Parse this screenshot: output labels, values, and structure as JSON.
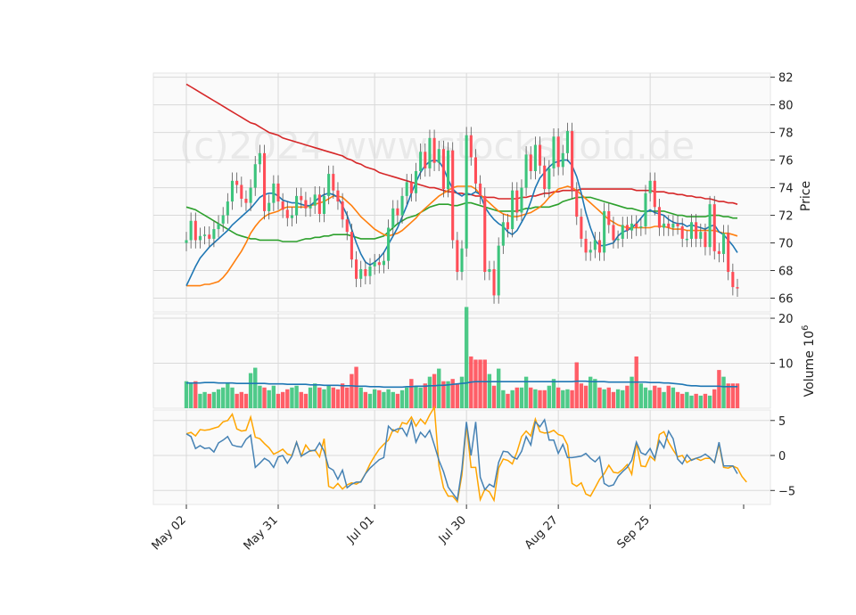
{
  "watermark": "(c)2024 www.stocksfloid.de",
  "colors": {
    "up": "#3cc47c",
    "down": "#ff4d57",
    "ma_fast": "#1f77b4",
    "ma_mid": "#ff7f0e",
    "ma_slow": "#2ca02c",
    "ma_long": "#d62728",
    "vol_ma": "#1f77b4",
    "macd": "#4682b4",
    "signal": "#ffa500"
  },
  "chart_data": {
    "type": "candlestick",
    "x_tick_labels": [
      "May 02",
      "May 31",
      "Jul 01",
      "Jul 30",
      "Aug 27",
      "Sep 25"
    ],
    "x_tick_index": [
      0,
      20,
      41,
      61,
      81,
      101
    ],
    "price_axis": {
      "label": "Price",
      "ticks": [
        66,
        68,
        70,
        72,
        74,
        76,
        78,
        80,
        82
      ],
      "ylim": [
        65,
        82.3
      ]
    },
    "volume_axis": {
      "label": "Volume  10^6",
      "ticks": [
        10,
        20
      ],
      "ylim": [
        0,
        21
      ]
    },
    "macd_axis": {
      "ticks": [
        -5,
        0,
        5
      ],
      "ylim": [
        -7,
        6.5
      ]
    },
    "close": [
      70.2,
      71.6,
      70.2,
      70.5,
      70.6,
      70.3,
      71.0,
      71.4,
      72.0,
      73.0,
      74.5,
      74.2,
      73.2,
      72.9,
      74.0,
      75.7,
      76.5,
      72.3,
      72.9,
      74.3,
      73.0,
      72.4,
      71.8,
      72.0,
      73.4,
      73.1,
      72.5,
      72.7,
      73.5,
      72.1,
      73.4,
      75.0,
      73.8,
      73.0,
      71.7,
      70.8,
      68.8,
      67.4,
      68.1,
      67.6,
      68.3,
      68.6,
      68.4,
      68.7,
      71.1,
      72.5,
      72.0,
      73.4,
      74.4,
      73.6,
      75.2,
      76.6,
      75.4,
      77.6,
      75.8,
      76.8,
      73.9,
      76.7,
      70.2,
      67.9,
      69.6,
      77.8,
      76.2,
      74.3,
      73.4,
      67.9,
      68.1,
      66.2,
      69.8,
      71.5,
      71.0,
      73.8,
      72.2,
      74.0,
      76.4,
      75.2,
      77.1,
      75.6,
      73.9,
      75.4,
      77.7,
      75.5,
      76.5,
      78.1,
      73.8,
      71.9,
      70.3,
      69.3,
      69.5,
      70.2,
      69.3,
      72.3,
      71.3,
      70.2,
      70.3,
      71.3,
      70.9,
      71.4,
      71.1,
      71.2,
      73.6,
      74.5,
      72.6,
      71.1,
      71.4,
      71.1,
      71.4,
      71.2,
      70.3,
      70.3,
      71.5,
      70.3,
      70.8,
      69.7,
      72.8,
      69.4,
      69.2,
      70.7,
      67.9,
      66.8,
      66.7
    ],
    "open": [
      70.0,
      70.2,
      71.6,
      70.2,
      70.5,
      70.6,
      70.3,
      71.0,
      71.4,
      72.0,
      73.0,
      74.5,
      74.2,
      73.2,
      72.9,
      74.0,
      75.7,
      76.5,
      72.3,
      72.9,
      74.3,
      73.0,
      72.4,
      71.8,
      72.0,
      73.4,
      73.1,
      72.5,
      72.7,
      73.5,
      72.1,
      73.4,
      75.0,
      73.8,
      73.0,
      71.7,
      70.8,
      68.8,
      67.4,
      68.1,
      67.6,
      68.3,
      68.6,
      68.4,
      68.7,
      71.1,
      72.5,
      72.0,
      73.4,
      74.4,
      73.6,
      75.2,
      76.6,
      75.4,
      77.6,
      75.8,
      76.8,
      73.9,
      76.7,
      70.2,
      67.9,
      69.6,
      77.8,
      76.2,
      74.3,
      73.4,
      67.9,
      68.1,
      66.2,
      69.8,
      71.5,
      71.0,
      73.8,
      72.2,
      74.0,
      76.4,
      75.2,
      77.1,
      75.6,
      73.9,
      75.4,
      77.7,
      75.5,
      76.5,
      78.1,
      73.8,
      71.9,
      70.3,
      69.3,
      69.5,
      70.2,
      69.3,
      72.3,
      71.3,
      70.2,
      70.3,
      71.3,
      70.9,
      71.4,
      71.1,
      71.2,
      73.6,
      74.5,
      72.6,
      71.1,
      71.4,
      71.1,
      71.4,
      71.2,
      70.3,
      70.3,
      71.5,
      70.3,
      70.8,
      69.7,
      72.8,
      69.4,
      69.2,
      70.7,
      67.9,
      66.8
    ],
    "volume": [
      6.0,
      5.5,
      6.0,
      3.2,
      3.6,
      3.2,
      3.6,
      4.2,
      4.6,
      5.5,
      4.6,
      3.2,
      3.6,
      3.2,
      7.8,
      9.0,
      5.0,
      4.6,
      4.0,
      5.0,
      3.2,
      3.6,
      4.2,
      4.6,
      5.0,
      3.6,
      3.2,
      4.6,
      5.5,
      4.6,
      4.2,
      5.0,
      4.6,
      4.2,
      5.5,
      4.6,
      7.6,
      9.2,
      4.6,
      3.6,
      3.2,
      4.2,
      4.0,
      3.6,
      4.2,
      3.6,
      3.2,
      4.0,
      4.6,
      6.5,
      5.0,
      4.6,
      5.5,
      7.0,
      7.6,
      8.8,
      6.0,
      6.0,
      6.5,
      5.5,
      7.0,
      22.5,
      11.5,
      10.8,
      10.8,
      10.8,
      7.6,
      5.0,
      8.8,
      4.0,
      3.2,
      4.0,
      4.6,
      4.6,
      7.0,
      4.6,
      4.2,
      4.0,
      4.0,
      5.0,
      6.5,
      4.6,
      4.0,
      4.2,
      4.0,
      10.2,
      5.5,
      5.0,
      7.0,
      6.5,
      4.6,
      4.2,
      4.6,
      3.6,
      4.2,
      4.0,
      5.0,
      7.0,
      11.5,
      5.5,
      4.6,
      4.0,
      5.0,
      4.6,
      3.6,
      5.0,
      4.6,
      3.6,
      3.2,
      3.6,
      2.8,
      3.2,
      2.8,
      3.2,
      2.8,
      4.2,
      8.5,
      7.0,
      5.5,
      5.5,
      5.5
    ],
    "ma_fast": [
      66.9,
      67.6,
      68.3,
      68.9,
      69.3,
      69.7,
      70.0,
      70.3,
      70.6,
      70.9,
      71.3,
      71.6,
      71.9,
      72.2,
      72.5,
      72.9,
      73.3,
      73.5,
      73.6,
      73.6,
      73.4,
      73.1,
      73.0,
      72.9,
      72.9,
      72.8,
      72.7,
      72.7,
      73.0,
      73.3,
      73.5,
      73.6,
      73.5,
      73.3,
      72.7,
      72.0,
      71.0,
      70.0,
      69.2,
      68.6,
      68.4,
      68.6,
      68.9,
      69.3,
      69.9,
      70.5,
      71.1,
      71.9,
      72.7,
      73.6,
      74.4,
      75.1,
      75.6,
      75.9,
      76.0,
      75.9,
      75.4,
      74.6,
      73.9,
      73.6,
      73.4,
      73.6,
      73.5,
      73.7,
      73.5,
      72.6,
      72.1,
      71.7,
      71.4,
      71.2,
      70.8,
      70.6,
      70.9,
      71.5,
      72.1,
      73.0,
      74.0,
      74.7,
      75.1,
      75.5,
      75.8,
      75.9,
      76.0,
      76.0,
      75.6,
      74.8,
      73.6,
      72.2,
      71.1,
      70.2,
      69.8,
      69.8,
      69.9,
      70.0,
      70.5,
      70.8,
      70.9,
      71.1,
      71.4,
      71.8,
      72.2,
      72.4,
      72.2,
      72.1,
      72.0,
      71.7,
      71.5,
      71.4,
      71.4,
      71.2,
      71.3,
      71.2,
      71.1,
      71.0,
      71.2,
      71.3,
      70.8,
      70.6,
      70.2,
      69.8,
      69.3
    ],
    "ma_mid": [
      66.9,
      66.9,
      66.9,
      66.9,
      67.0,
      67.0,
      67.1,
      67.2,
      67.5,
      67.9,
      68.4,
      68.9,
      69.4,
      70.0,
      70.7,
      71.2,
      71.6,
      71.9,
      72.1,
      72.2,
      72.3,
      72.5,
      72.6,
      72.6,
      72.6,
      72.6,
      72.6,
      72.7,
      72.8,
      72.9,
      73.0,
      73.2,
      73.4,
      73.4,
      73.3,
      73.0,
      72.7,
      72.3,
      71.9,
      71.6,
      71.3,
      71.0,
      70.8,
      70.6,
      70.5,
      70.6,
      70.7,
      70.9,
      71.2,
      71.5,
      71.8,
      72.2,
      72.5,
      72.8,
      73.1,
      73.4,
      73.6,
      73.8,
      74.0,
      74.1,
      74.1,
      74.1,
      74.1,
      73.9,
      73.5,
      73.2,
      72.9,
      72.6,
      72.3,
      72.1,
      72.0,
      71.9,
      71.9,
      72.0,
      72.1,
      72.2,
      72.4,
      72.6,
      72.9,
      73.3,
      73.6,
      73.9,
      74.0,
      74.1,
      74.0,
      73.8,
      73.5,
      73.2,
      72.9,
      72.6,
      72.3,
      72.0,
      71.7,
      71.5,
      71.3,
      71.2,
      71.1,
      71.1,
      71.1,
      71.1,
      71.1,
      71.1,
      71.2,
      71.2,
      71.2,
      71.1,
      71.0,
      71.0,
      71.0,
      70.9,
      70.9,
      70.9,
      70.9,
      70.9,
      70.9,
      70.9,
      70.8,
      70.7,
      70.7,
      70.6,
      70.5
    ],
    "ma_slow": [
      72.6,
      72.5,
      72.4,
      72.2,
      72.0,
      71.8,
      71.6,
      71.4,
      71.2,
      71.0,
      70.8,
      70.6,
      70.5,
      70.4,
      70.3,
      70.3,
      70.2,
      70.2,
      70.2,
      70.2,
      70.2,
      70.1,
      70.1,
      70.1,
      70.1,
      70.2,
      70.3,
      70.3,
      70.4,
      70.4,
      70.5,
      70.5,
      70.6,
      70.6,
      70.6,
      70.6,
      70.5,
      70.4,
      70.3,
      70.3,
      70.3,
      70.3,
      70.4,
      70.5,
      70.8,
      71.1,
      71.4,
      71.6,
      71.8,
      71.9,
      72.0,
      72.2,
      72.4,
      72.6,
      72.7,
      72.8,
      72.8,
      72.8,
      72.7,
      72.7,
      72.8,
      72.9,
      72.9,
      72.8,
      72.7,
      72.6,
      72.5,
      72.4,
      72.3,
      72.3,
      72.3,
      72.3,
      72.3,
      72.4,
      72.5,
      72.5,
      72.6,
      72.6,
      72.6,
      72.6,
      72.7,
      72.8,
      73.0,
      73.1,
      73.2,
      73.3,
      73.3,
      73.3,
      73.3,
      73.2,
      73.1,
      73.0,
      72.9,
      72.8,
      72.7,
      72.6,
      72.5,
      72.5,
      72.4,
      72.3,
      72.3,
      72.3,
      72.3,
      72.3,
      72.3,
      72.2,
      72.1,
      72.0,
      72.0,
      71.9,
      71.9,
      71.9,
      71.9,
      71.9,
      72.0,
      72.0,
      72.0,
      71.9,
      71.9,
      71.8,
      71.8
    ],
    "ma_long": [
      81.5,
      81.3,
      81.1,
      80.9,
      80.7,
      80.5,
      80.3,
      80.1,
      79.9,
      79.7,
      79.5,
      79.3,
      79.1,
      78.9,
      78.7,
      78.6,
      78.4,
      78.2,
      78.0,
      77.9,
      77.8,
      77.6,
      77.5,
      77.4,
      77.3,
      77.2,
      77.1,
      77.0,
      76.9,
      76.8,
      76.7,
      76.6,
      76.5,
      76.4,
      76.3,
      76.1,
      76.0,
      75.8,
      75.7,
      75.5,
      75.4,
      75.3,
      75.1,
      75.0,
      74.9,
      74.8,
      74.7,
      74.6,
      74.5,
      74.4,
      74.3,
      74.2,
      74.1,
      74.0,
      74.0,
      73.9,
      73.8,
      73.7,
      73.7,
      73.6,
      73.6,
      73.5,
      73.5,
      73.4,
      73.4,
      73.3,
      73.3,
      73.3,
      73.2,
      73.2,
      73.2,
      73.2,
      73.2,
      73.3,
      73.3,
      73.4,
      73.4,
      73.5,
      73.6,
      73.6,
      73.7,
      73.7,
      73.8,
      73.8,
      73.8,
      73.8,
      73.9,
      73.9,
      73.9,
      73.9,
      73.9,
      73.9,
      73.9,
      73.9,
      73.9,
      73.9,
      73.9,
      73.9,
      73.8,
      73.8,
      73.8,
      73.8,
      73.7,
      73.7,
      73.7,
      73.6,
      73.6,
      73.5,
      73.5,
      73.4,
      73.4,
      73.3,
      73.3,
      73.2,
      73.2,
      73.1,
      73.0,
      73.0,
      72.9,
      72.9,
      72.8
    ],
    "vol_ma": [
      5.6,
      5.6,
      5.6,
      5.6,
      5.7,
      5.7,
      5.7,
      5.6,
      5.6,
      5.6,
      5.6,
      5.5,
      5.5,
      5.5,
      5.5,
      5.5,
      5.5,
      5.5,
      5.4,
      5.4,
      5.4,
      5.4,
      5.3,
      5.3,
      5.3,
      5.3,
      5.3,
      5.2,
      5.2,
      5.2,
      5.1,
      5.1,
      5.1,
      5.1,
      5.0,
      5.0,
      5.0,
      4.9,
      4.9,
      4.9,
      4.8,
      4.8,
      4.8,
      4.7,
      4.7,
      4.7,
      4.7,
      4.7,
      4.8,
      4.8,
      4.9,
      4.9,
      4.9,
      5.0,
      5.0,
      5.1,
      5.1,
      5.2,
      5.3,
      5.4,
      5.5,
      5.6,
      5.8,
      5.9,
      5.9,
      5.9,
      5.9,
      5.9,
      5.9,
      5.9,
      5.9,
      5.9,
      5.9,
      5.9,
      5.9,
      5.9,
      5.9,
      5.9,
      5.9,
      5.9,
      5.9,
      5.9,
      5.9,
      5.9,
      5.9,
      6.0,
      6.0,
      6.0,
      5.9,
      5.9,
      5.9,
      5.9,
      5.8,
      5.8,
      5.8,
      5.8,
      5.8,
      5.8,
      5.8,
      5.8,
      5.8,
      5.7,
      5.7,
      5.7,
      5.6,
      5.6,
      5.5,
      5.4,
      5.3,
      5.1,
      5.0,
      5.0,
      4.9,
      4.9,
      4.9,
      4.9,
      4.9,
      4.8,
      4.8,
      4.8,
      4.8
    ],
    "macd": [
      3.1,
      2.7,
      1.0,
      1.4,
      1.0,
      1.1,
      0.5,
      1.8,
      2.2,
      2.7,
      1.5,
      1.3,
      1.2,
      2.3,
      2.9,
      -1.7,
      -1.1,
      -0.4,
      -0.8,
      -1.7,
      -0.2,
      0.0,
      -1.1,
      -0.1,
      1.9,
      -0.1,
      0.3,
      0.7,
      0.7,
      1.8,
      0.6,
      -1.7,
      -2.1,
      -3.4,
      -2.1,
      -4.6,
      -4.1,
      -3.8,
      -3.8,
      -2.6,
      -1.8,
      -1.2,
      -0.6,
      -0.3,
      4.2,
      3.5,
      3.8,
      3.9,
      2.8,
      4.9,
      1.9,
      3.3,
      2.6,
      3.6,
      1.5,
      -0.7,
      -2.3,
      -4.5,
      -5.4,
      -6.3,
      -2.0,
      4.8,
      0.0,
      4.8,
      -3.1,
      -4.9,
      -4.1,
      -4.5,
      -1.0,
      0.6,
      0.5,
      -0.2,
      -0.5,
      0.6,
      2.7,
      1.5,
      4.8,
      4.1,
      5.1,
      2.2,
      2.2,
      0.3,
      1.6,
      -0.3,
      -0.3,
      -0.2,
      -0.1,
      0.3,
      -0.4,
      -0.9,
      -0.2,
      -4.0,
      -4.4,
      -4.2,
      -3.0,
      -2.3,
      -1.7,
      -0.7,
      1.9,
      0.4,
      0.1,
      1.0,
      -0.4,
      2.1,
      1.1,
      3.5,
      2.4,
      -0.5,
      -1.2,
      0.1,
      -0.7,
      -0.4,
      -0.2,
      0.2,
      -0.3,
      -1.0,
      1.9,
      -1.5,
      -1.5,
      -1.5,
      -2.6
    ],
    "signal": [
      3.1,
      3.3,
      2.8,
      3.7,
      3.6,
      3.7,
      3.9,
      4.1,
      4.8,
      5.0,
      5.9,
      3.8,
      3.5,
      3.6,
      5.5,
      2.6,
      2.4,
      1.7,
      1.1,
      0.2,
      0.5,
      0.9,
      0.2,
      0.0,
      1.9,
      -0.1,
      1.5,
      0.6,
      0.8,
      -0.2,
      2.4,
      -4.4,
      -4.7,
      -4.0,
      -4.8,
      -4.2,
      -3.9,
      -4.1,
      -3.7,
      -2.6,
      -1.2,
      -0.1,
      0.9,
      1.6,
      2.2,
      3.7,
      3.3,
      4.7,
      4.5,
      5.5,
      4.2,
      5.2,
      4.5,
      5.8,
      6.9,
      -1.5,
      -4.6,
      -5.8,
      -5.8,
      -6.6,
      -2.8,
      4.4,
      -1.7,
      -1.7,
      -6.3,
      -4.8,
      -5.2,
      -6.4,
      -1.8,
      -0.5,
      -0.7,
      -1.2,
      0.5,
      2.7,
      3.5,
      2.8,
      5.2,
      3.4,
      3.2,
      3.3,
      3.6,
      3.0,
      2.8,
      1.5,
      -4.0,
      -4.4,
      -3.9,
      -5.5,
      -5.8,
      -4.6,
      -3.4,
      -2.6,
      -1.4,
      -2.4,
      -2.5,
      -2.0,
      -1.3,
      -2.7,
      1.8,
      -1.5,
      -1.6,
      -0.1,
      -0.7,
      3.0,
      3.4,
      1.9,
      0.8,
      -0.2,
      0.0,
      -1.0,
      -0.6,
      -0.4,
      -0.7,
      -0.4,
      -0.4,
      -1.0,
      1.6,
      -1.7,
      -1.8,
      -1.5,
      -1.8,
      -3.0,
      -3.8
    ]
  }
}
